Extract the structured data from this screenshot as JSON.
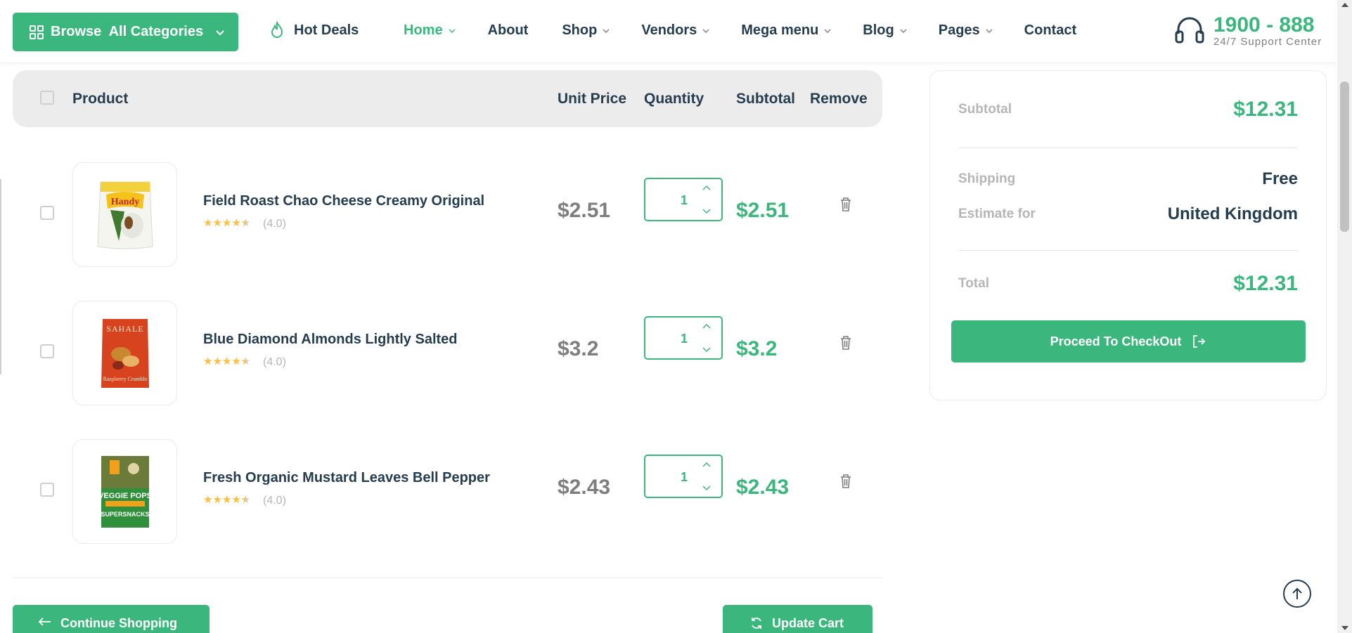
{
  "header": {
    "browse_label": "Browse  All Categories",
    "hot_deals": "Hot Deals",
    "nav": [
      {
        "label": "Home",
        "dropdown": true,
        "active": true
      },
      {
        "label": "About",
        "dropdown": false
      },
      {
        "label": "Shop",
        "dropdown": true
      },
      {
        "label": "Vendors",
        "dropdown": true
      },
      {
        "label": "Mega menu",
        "dropdown": true
      },
      {
        "label": "Blog",
        "dropdown": true
      },
      {
        "label": "Pages",
        "dropdown": true
      },
      {
        "label": "Contact",
        "dropdown": false
      }
    ],
    "support_phone": "1900 - 888",
    "support_text": "24/7 Support Center"
  },
  "cart": {
    "columns": {
      "product": "Product",
      "unit_price": "Unit Price",
      "quantity": "Quantity",
      "subtotal": "Subtotal",
      "remove": "Remove"
    },
    "items": [
      {
        "name": "Field Roast Chao Cheese Creamy Original",
        "rating": 4.0,
        "rating_text": "(4.0)",
        "price": "$2.51",
        "qty": "1",
        "subtotal": "$2.51",
        "thumb_icon": "snack-bag-icon"
      },
      {
        "name": "Blue Diamond Almonds Lightly Salted",
        "rating": 4.0,
        "rating_text": "(4.0)",
        "price": "$3.2",
        "qty": "1",
        "subtotal": "$3.2",
        "thumb_icon": "snack-bag-icon"
      },
      {
        "name": "Fresh Organic Mustard Leaves Bell Pepper",
        "rating": 4.0,
        "rating_text": "(4.0)",
        "price": "$2.43",
        "qty": "1",
        "subtotal": "$2.43",
        "thumb_icon": "snack-bag-icon"
      }
    ],
    "continue_label": "Continue Shopping",
    "update_label": "Update Cart"
  },
  "summary": {
    "subtotal_label": "Subtotal",
    "subtotal_value": "$12.31",
    "shipping_label": "Shipping",
    "shipping_value": "Free",
    "estimate_label": "Estimate for",
    "estimate_value": "United Kingdom",
    "total_label": "Total",
    "total_value": "$12.31",
    "checkout_label": "Proceed To CheckOut"
  },
  "colors": {
    "brand": "#3bb77e",
    "text": "#253d4e",
    "muted": "#b6b6b6",
    "star": "#fdc040"
  }
}
